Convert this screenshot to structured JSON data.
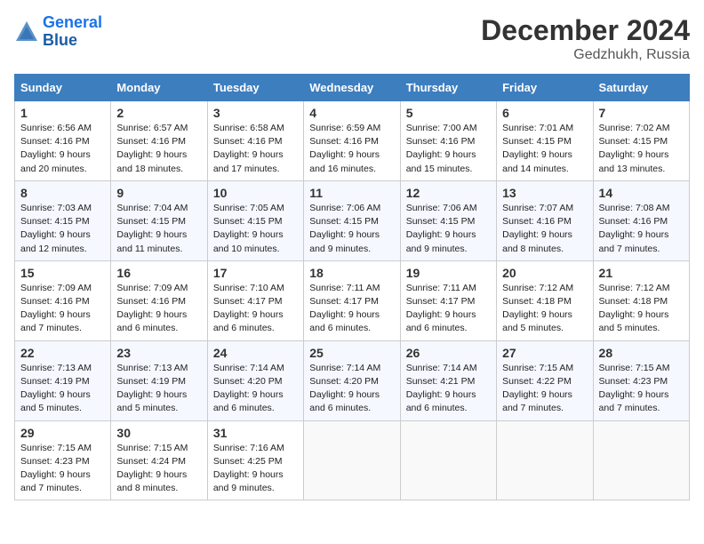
{
  "header": {
    "logo_line1": "General",
    "logo_line2": "Blue",
    "title": "December 2024",
    "subtitle": "Gedzhukh, Russia"
  },
  "days_of_week": [
    "Sunday",
    "Monday",
    "Tuesday",
    "Wednesday",
    "Thursday",
    "Friday",
    "Saturday"
  ],
  "weeks": [
    [
      {
        "day": 1,
        "info": "Sunrise: 6:56 AM\nSunset: 4:16 PM\nDaylight: 9 hours\nand 20 minutes."
      },
      {
        "day": 2,
        "info": "Sunrise: 6:57 AM\nSunset: 4:16 PM\nDaylight: 9 hours\nand 18 minutes."
      },
      {
        "day": 3,
        "info": "Sunrise: 6:58 AM\nSunset: 4:16 PM\nDaylight: 9 hours\nand 17 minutes."
      },
      {
        "day": 4,
        "info": "Sunrise: 6:59 AM\nSunset: 4:16 PM\nDaylight: 9 hours\nand 16 minutes."
      },
      {
        "day": 5,
        "info": "Sunrise: 7:00 AM\nSunset: 4:16 PM\nDaylight: 9 hours\nand 15 minutes."
      },
      {
        "day": 6,
        "info": "Sunrise: 7:01 AM\nSunset: 4:15 PM\nDaylight: 9 hours\nand 14 minutes."
      },
      {
        "day": 7,
        "info": "Sunrise: 7:02 AM\nSunset: 4:15 PM\nDaylight: 9 hours\nand 13 minutes."
      }
    ],
    [
      {
        "day": 8,
        "info": "Sunrise: 7:03 AM\nSunset: 4:15 PM\nDaylight: 9 hours\nand 12 minutes."
      },
      {
        "day": 9,
        "info": "Sunrise: 7:04 AM\nSunset: 4:15 PM\nDaylight: 9 hours\nand 11 minutes."
      },
      {
        "day": 10,
        "info": "Sunrise: 7:05 AM\nSunset: 4:15 PM\nDaylight: 9 hours\nand 10 minutes."
      },
      {
        "day": 11,
        "info": "Sunrise: 7:06 AM\nSunset: 4:15 PM\nDaylight: 9 hours\nand 9 minutes."
      },
      {
        "day": 12,
        "info": "Sunrise: 7:06 AM\nSunset: 4:15 PM\nDaylight: 9 hours\nand 9 minutes."
      },
      {
        "day": 13,
        "info": "Sunrise: 7:07 AM\nSunset: 4:16 PM\nDaylight: 9 hours\nand 8 minutes."
      },
      {
        "day": 14,
        "info": "Sunrise: 7:08 AM\nSunset: 4:16 PM\nDaylight: 9 hours\nand 7 minutes."
      }
    ],
    [
      {
        "day": 15,
        "info": "Sunrise: 7:09 AM\nSunset: 4:16 PM\nDaylight: 9 hours\nand 7 minutes."
      },
      {
        "day": 16,
        "info": "Sunrise: 7:09 AM\nSunset: 4:16 PM\nDaylight: 9 hours\nand 6 minutes."
      },
      {
        "day": 17,
        "info": "Sunrise: 7:10 AM\nSunset: 4:17 PM\nDaylight: 9 hours\nand 6 minutes."
      },
      {
        "day": 18,
        "info": "Sunrise: 7:11 AM\nSunset: 4:17 PM\nDaylight: 9 hours\nand 6 minutes."
      },
      {
        "day": 19,
        "info": "Sunrise: 7:11 AM\nSunset: 4:17 PM\nDaylight: 9 hours\nand 6 minutes."
      },
      {
        "day": 20,
        "info": "Sunrise: 7:12 AM\nSunset: 4:18 PM\nDaylight: 9 hours\nand 5 minutes."
      },
      {
        "day": 21,
        "info": "Sunrise: 7:12 AM\nSunset: 4:18 PM\nDaylight: 9 hours\nand 5 minutes."
      }
    ],
    [
      {
        "day": 22,
        "info": "Sunrise: 7:13 AM\nSunset: 4:19 PM\nDaylight: 9 hours\nand 5 minutes."
      },
      {
        "day": 23,
        "info": "Sunrise: 7:13 AM\nSunset: 4:19 PM\nDaylight: 9 hours\nand 5 minutes."
      },
      {
        "day": 24,
        "info": "Sunrise: 7:14 AM\nSunset: 4:20 PM\nDaylight: 9 hours\nand 6 minutes."
      },
      {
        "day": 25,
        "info": "Sunrise: 7:14 AM\nSunset: 4:20 PM\nDaylight: 9 hours\nand 6 minutes."
      },
      {
        "day": 26,
        "info": "Sunrise: 7:14 AM\nSunset: 4:21 PM\nDaylight: 9 hours\nand 6 minutes."
      },
      {
        "day": 27,
        "info": "Sunrise: 7:15 AM\nSunset: 4:22 PM\nDaylight: 9 hours\nand 7 minutes."
      },
      {
        "day": 28,
        "info": "Sunrise: 7:15 AM\nSunset: 4:23 PM\nDaylight: 9 hours\nand 7 minutes."
      }
    ],
    [
      {
        "day": 29,
        "info": "Sunrise: 7:15 AM\nSunset: 4:23 PM\nDaylight: 9 hours\nand 7 minutes."
      },
      {
        "day": 30,
        "info": "Sunrise: 7:15 AM\nSunset: 4:24 PM\nDaylight: 9 hours\nand 8 minutes."
      },
      {
        "day": 31,
        "info": "Sunrise: 7:16 AM\nSunset: 4:25 PM\nDaylight: 9 hours\nand 9 minutes."
      },
      null,
      null,
      null,
      null
    ]
  ]
}
